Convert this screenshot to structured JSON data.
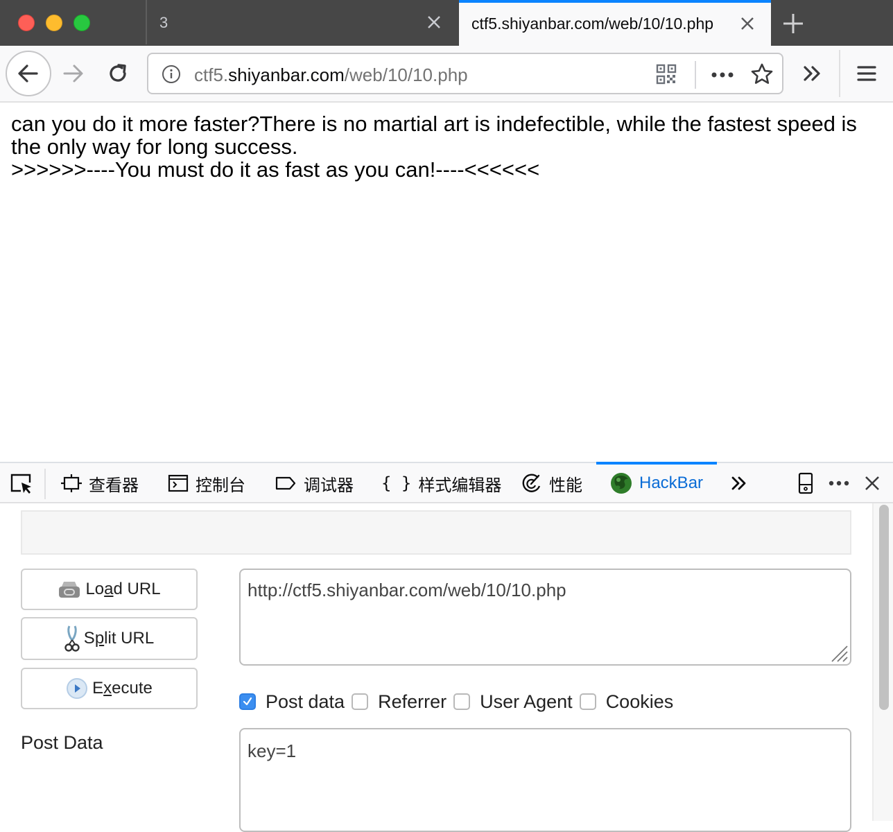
{
  "browser": {
    "tabs": [
      {
        "title": "3",
        "active": false
      },
      {
        "title": "ctf5.shiyanbar.com/web/10/10.php",
        "active": true
      }
    ],
    "accent_color": "#0a84ff",
    "url": {
      "prefix": "ctf5.",
      "host": "shiyanbar.com",
      "path": "/web/10/10.php"
    },
    "icons": {
      "back": "arrow-left-icon",
      "forward": "arrow-right-icon",
      "reload": "reload-icon",
      "info": "info-icon",
      "qr": "qr-code-icon",
      "more": "more-dots-icon",
      "bookmark": "star-icon",
      "overflow": "double-chevron-icon",
      "menu": "hamburger-icon"
    }
  },
  "page": {
    "line1": "can you do it more faster?There is no martial art is indefectible, while the fastest speed is the only way for long success.",
    "line2": ">>>>>>----You must do it as fast as you can!----<<<<<<"
  },
  "devtools": {
    "tabs": [
      {
        "label": "查看器",
        "icon": "inspector-icon"
      },
      {
        "label": "控制台",
        "icon": "console-icon"
      },
      {
        "label": "调试器",
        "icon": "debugger-icon"
      },
      {
        "label": "样式编辑器",
        "icon": "style-editor-icon"
      },
      {
        "label": "性能",
        "icon": "performance-icon"
      },
      {
        "label": "HackBar",
        "icon": "hackbar-icon",
        "active": true
      }
    ]
  },
  "hackbar": {
    "buttons": {
      "load_url": {
        "pre": "Lo",
        "accel": "a",
        "post": "d URL"
      },
      "split_url": {
        "pre": "S",
        "accel": "p",
        "post": "lit URL"
      },
      "execute": {
        "pre": "E",
        "accel": "x",
        "post": "ecute"
      }
    },
    "url_value": "http://ctf5.shiyanbar.com/web/10/10.php",
    "options": [
      {
        "label": "Post data",
        "checked": true
      },
      {
        "label": "Referrer",
        "checked": false
      },
      {
        "label": "User Agent",
        "checked": false
      },
      {
        "label": "Cookies",
        "checked": false
      }
    ],
    "post_data_label": "Post Data",
    "post_data_value": "key=1"
  }
}
